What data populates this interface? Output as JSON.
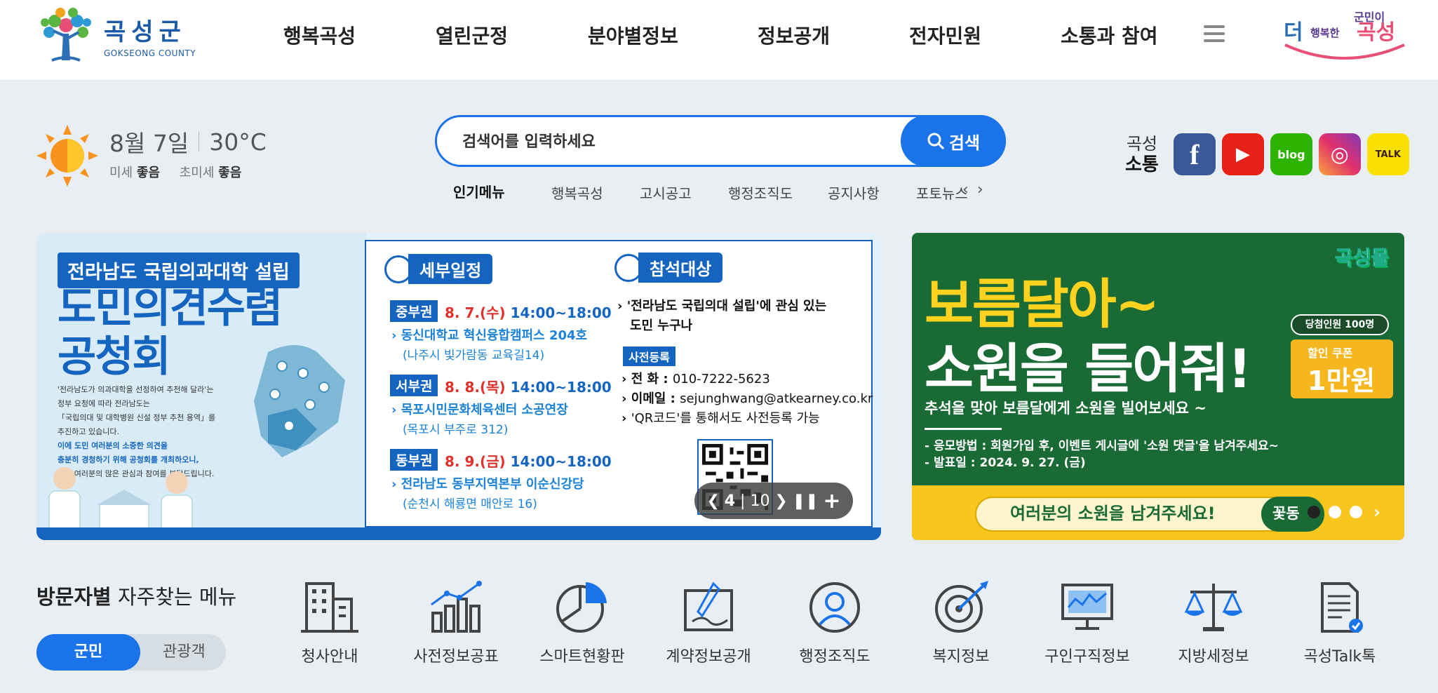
{
  "header": {
    "logo": {
      "title_ko": "곡성군",
      "title_en": "GOKSEONG COUNTY"
    },
    "nav": [
      "행복곡성",
      "열린군정",
      "분야별정보",
      "정보공개",
      "전자민원",
      "소통과 참여"
    ],
    "slogan": "군민이 더 행복한 곡성"
  },
  "weather": {
    "date": "8월 7일",
    "temperature": "30°C",
    "fine_dust_label": "미세",
    "fine_dust_value": "좋음",
    "ultrafine_dust_label": "초미세",
    "ultrafine_dust_value": "좋음"
  },
  "search": {
    "placeholder": "검색어를 입력하세요",
    "button": "검색",
    "popular_label": "인기메뉴",
    "popular_items": [
      "행복곡성",
      "고시공고",
      "행정조직도",
      "공지사항",
      "포토뉴스"
    ]
  },
  "sns": {
    "label1": "곡성",
    "label2": "소통",
    "icons": [
      {
        "name": "facebook",
        "glyph": "f",
        "color": "#3b5998"
      },
      {
        "name": "youtube",
        "glyph": "▶",
        "color": "#e62117"
      },
      {
        "name": "blog",
        "glyph": "blog",
        "color": "#2db400"
      },
      {
        "name": "instagram",
        "glyph": "◎",
        "color": "#c13584"
      },
      {
        "name": "kakaotalk",
        "glyph": "TALK",
        "color": "#f9e000"
      }
    ]
  },
  "banner_main": {
    "tag": "전라남도 국립의과대학 설립",
    "headline_1": "도민의견수렴",
    "headline_2": "공청회",
    "desc_1": "'전라남도가 의과대학을 선정하여 추천해 달라'는",
    "desc_2": "정부 요청에 따라 전라남도는",
    "desc_3": "「국립의대 및 대학병원 신설 정부 추천 용역」를",
    "desc_4": "추진하고 있습니다.",
    "desc_5": "이에 도민 여러분의 소중한 의견을",
    "desc_6": "충분히 경청하기 위해 공청회를 개최하오니,",
    "desc_7": "도민 여러분의 많은 관심과 참여를 부탁드립니다.",
    "schedule_title": "세부일정",
    "schedule": [
      {
        "region": "중부권",
        "date": "8. 7.(수)",
        "time": "14:00~18:00",
        "place": "동신대학교 혁신융합캠퍼스 204호",
        "addr": "(나주시 빛가람동 교육길14)"
      },
      {
        "region": "서부권",
        "date": "8. 8.(목)",
        "time": "14:00~18:00",
        "place": "목포시민문화체육센터 소공연장",
        "addr": "(목포시 부주로 312)"
      },
      {
        "region": "동부권",
        "date": "8. 9.(금)",
        "time": "14:00~18:00",
        "place": "전라남도 동부지역본부 이순신강당",
        "addr": "(순천시 해룡면 매안로 16)"
      }
    ],
    "attendee_title": "참석대상",
    "attendee_1": "'전라남도 국립의대 설립'에 관심 있는",
    "attendee_2": "도민 누구나",
    "pre_reg": "사전등록",
    "phone_label": "전   화",
    "phone": "010-7222-5623",
    "email_label": "이메일",
    "email": "sejunghwang@atkearney.co.kr",
    "qr_note": "'QR코드'를 통해서도 사전등록 가능",
    "slide_current": "4",
    "slide_total": "10"
  },
  "banner_event": {
    "brand": "곡성몰",
    "headline_1": "보름달아~",
    "headline_2": "소원을 들어줘!",
    "subtitle": "추석을 맞아 보름달에게 소원을 빌어보세요 ~",
    "info_1": "- 응모방법 : 회원가입 후, 이벤트 게시글에 '소원 댓글'을 남겨주세요~",
    "info_2": "- 발표일 : 2024. 9. 27. (금)",
    "coupon_top": "당첨인원 100명",
    "coupon_small": "할인 쿠폰",
    "coupon_big": "1만원",
    "pill_text": "여러분의 소원을 남겨주세요!",
    "pill_btn": "꽃동",
    "dots": 3,
    "active_dot": 0
  },
  "quick": {
    "title_bold": "방문자별",
    "title_rest": "자주찾는 메뉴",
    "tab_on": "군민",
    "tab_off": "관광객",
    "items": [
      {
        "label": "청사안내",
        "icon": "building-icon"
      },
      {
        "label": "사전정보공표",
        "icon": "chart-icon"
      },
      {
        "label": "스마트현황판",
        "icon": "pie-icon"
      },
      {
        "label": "계약정보공개",
        "icon": "contract-icon"
      },
      {
        "label": "행정조직도",
        "icon": "person-icon"
      },
      {
        "label": "복지정보",
        "icon": "target-icon"
      },
      {
        "label": "구인구직정보",
        "icon": "monitor-icon"
      },
      {
        "label": "지방세정보",
        "icon": "scale-icon"
      },
      {
        "label": "곡성Talk톡",
        "icon": "document-icon"
      }
    ]
  }
}
